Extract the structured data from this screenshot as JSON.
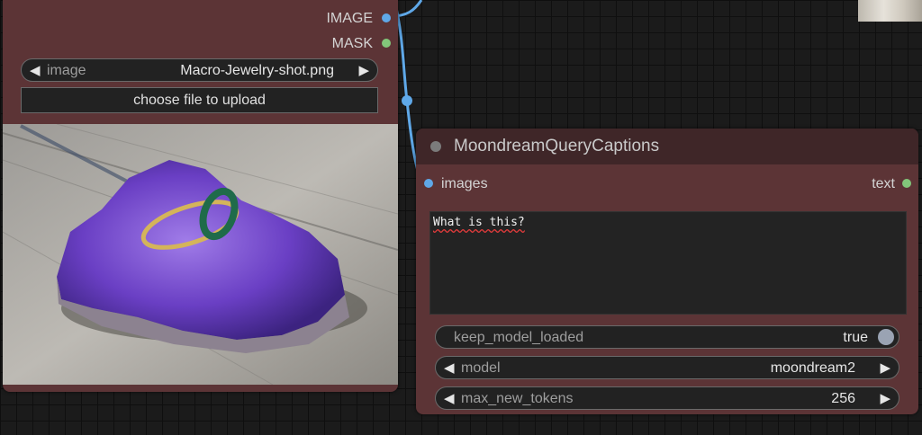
{
  "load_image_node": {
    "outputs": [
      {
        "label": "IMAGE",
        "color": "#5fa8e8"
      },
      {
        "label": "MASK",
        "color": "#82c77a"
      }
    ],
    "image_widget": {
      "label": "image",
      "value": "Macro-Jewelry-shot.png"
    },
    "upload_button": "choose file to upload"
  },
  "query_node": {
    "title": "MoondreamQueryCaptions",
    "input_slot": {
      "label": "images",
      "color": "#5fa8e8"
    },
    "output_slot": {
      "label": "text",
      "color": "#82c77a"
    },
    "prompt": "What is this?",
    "toggle": {
      "label": "keep_model_loaded",
      "value": "true"
    },
    "model": {
      "label": "model",
      "value": "moondream2"
    },
    "max_new_tokens": {
      "label": "max_new_tokens",
      "value": "256"
    }
  },
  "icons": {
    "left_arrow": "◀",
    "right_arrow": "▶"
  },
  "colors": {
    "canvas": "#1b1b1b",
    "node_body": "#5c3436",
    "node_header": "#3f2628",
    "wire": "#5fa8e8"
  }
}
